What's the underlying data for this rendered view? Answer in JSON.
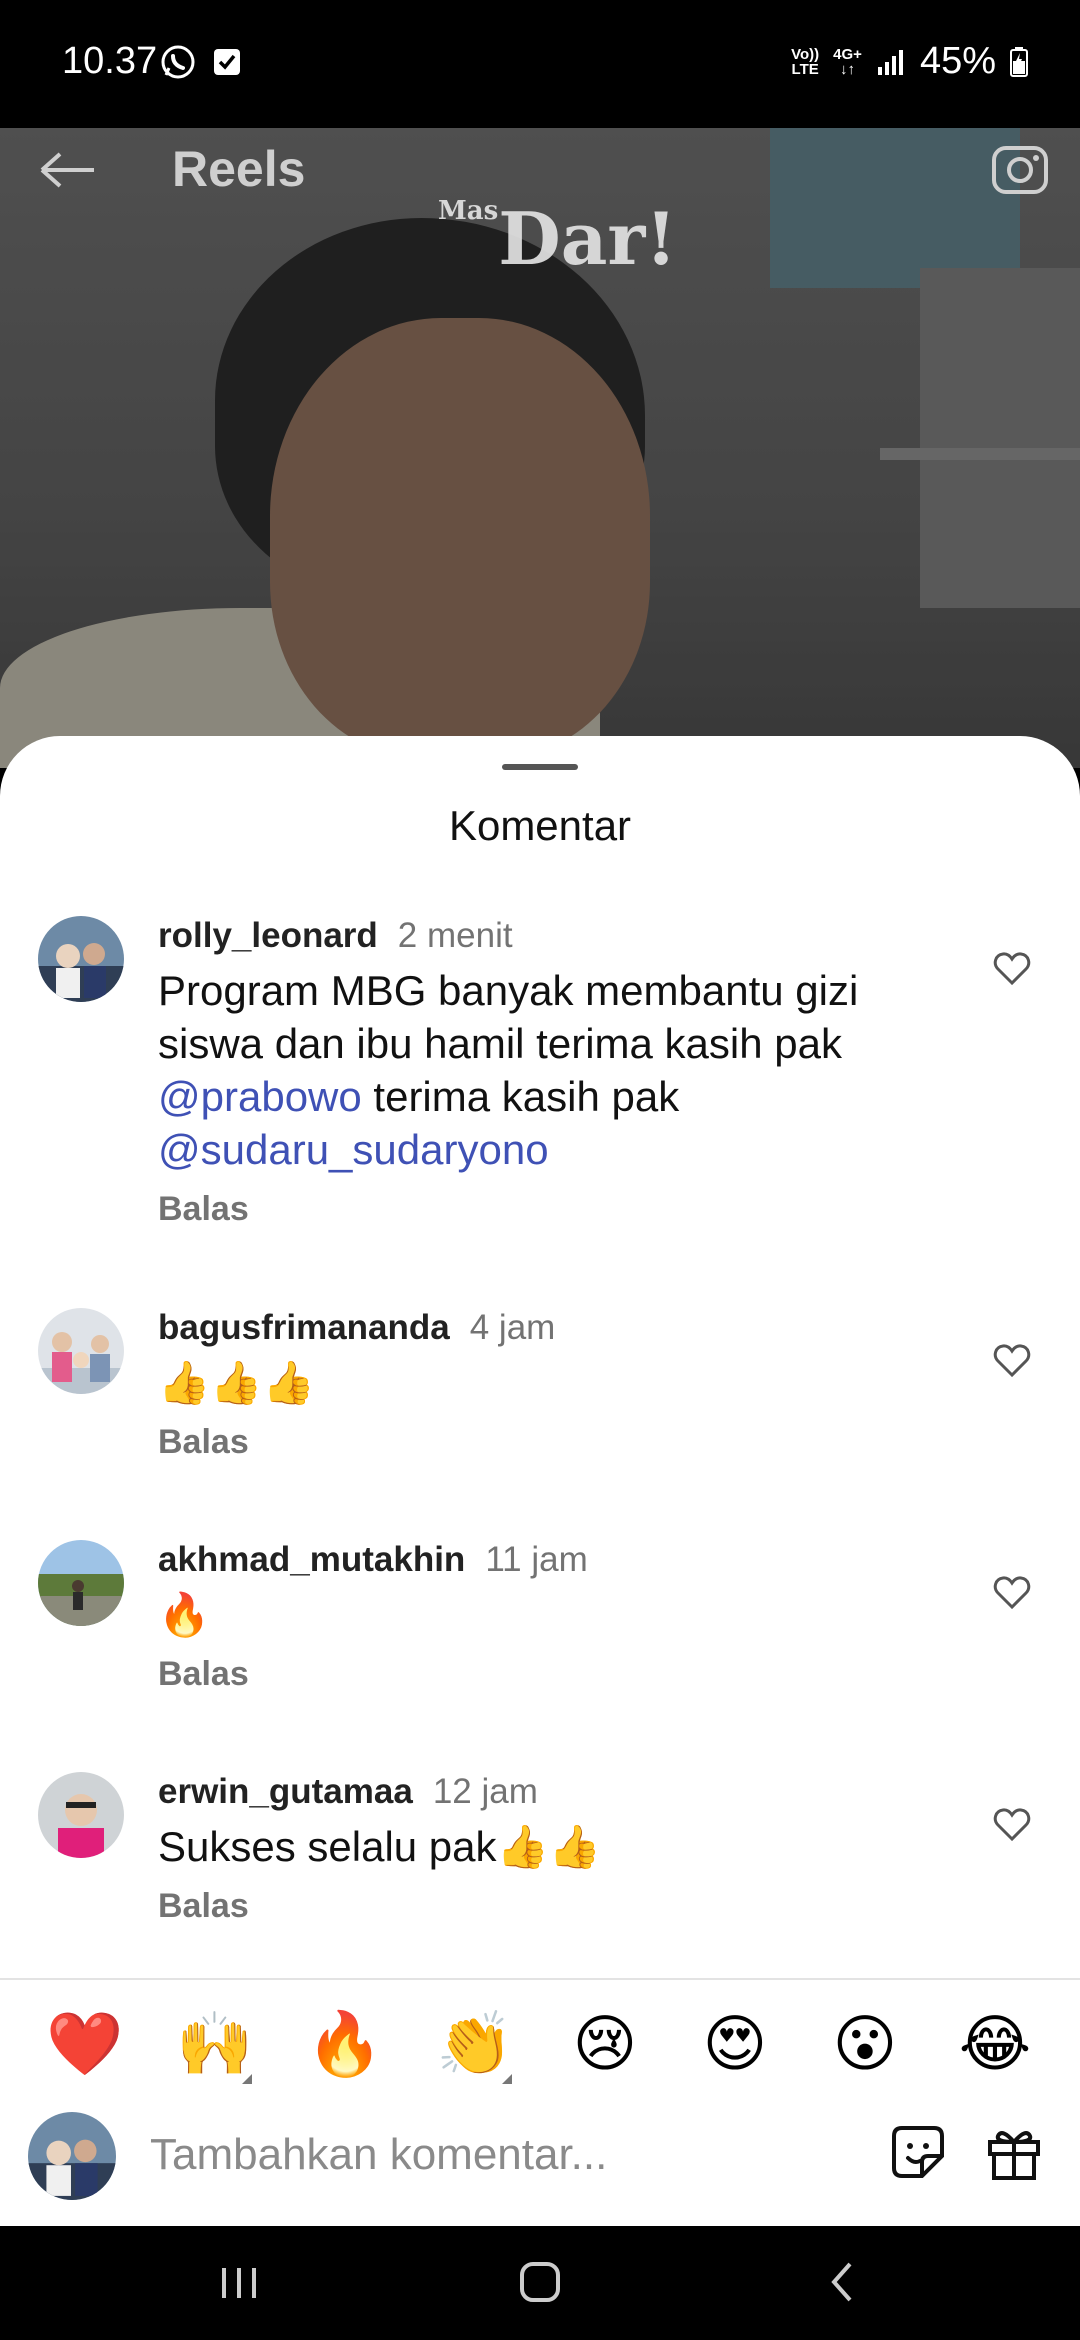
{
  "status_bar": {
    "time": "10.37",
    "network_top": "Vo))",
    "network_bottom": "LTE",
    "data_type": "4G+",
    "battery": "45%"
  },
  "reels": {
    "title": "Reels",
    "watermark_small": "Mas",
    "watermark_big": "Dar!"
  },
  "sheet": {
    "title": "Komentar"
  },
  "comments": [
    {
      "username": "rolly_leonard",
      "time": "2 menit",
      "text_1": "Program MBG banyak membantu gizi siswa dan ibu hamil terima kasih pak",
      "mention_1": "@prabowo",
      "text_2": " terima kasih pak",
      "mention_2": "@sudaru_sudaryono",
      "reply": "Balas"
    },
    {
      "username": "bagusfrimananda",
      "time": "4 jam",
      "text": "👍👍👍",
      "reply": "Balas"
    },
    {
      "username": "akhmad_mutakhin",
      "time": "11 jam",
      "text": "🔥",
      "reply": "Balas"
    },
    {
      "username": "erwin_gutamaa",
      "time": "12 jam",
      "text": "Sukses selalu pak👍👍",
      "reply": "Balas"
    }
  ],
  "emoji_bar": [
    "❤️",
    "🙌",
    "🔥",
    "👏",
    "😢",
    "😍",
    "😮",
    "😂"
  ],
  "composer": {
    "placeholder": "Tambahkan komentar..."
  },
  "icons": {
    "back": "back-arrow-icon",
    "camera": "camera-icon",
    "heart": "heart-outline-icon",
    "sticker": "sticker-icon",
    "gift": "gift-icon",
    "recents": "recents-icon",
    "home": "home-icon",
    "nav_back": "back-icon"
  },
  "colors": {
    "mention": "#3f51b5",
    "secondary_text": "#737373"
  }
}
